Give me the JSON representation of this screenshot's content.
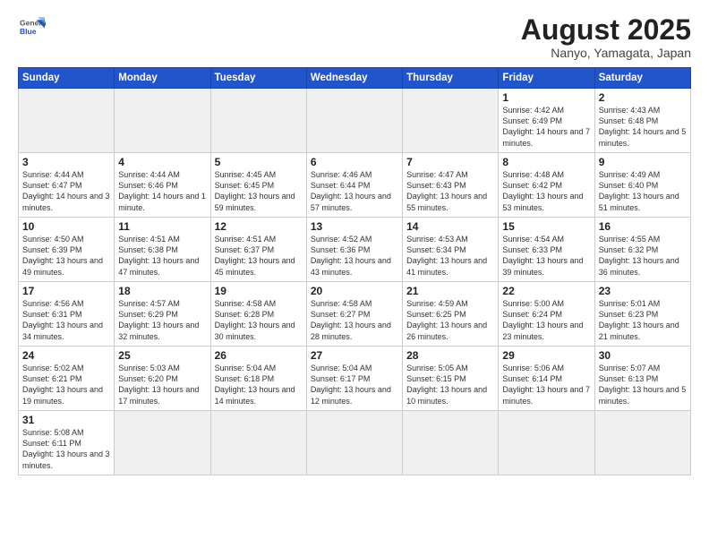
{
  "header": {
    "logo_general": "General",
    "logo_blue": "Blue",
    "month_title": "August 2025",
    "location": "Nanyo, Yamagata, Japan"
  },
  "weekdays": [
    "Sunday",
    "Monday",
    "Tuesday",
    "Wednesday",
    "Thursday",
    "Friday",
    "Saturday"
  ],
  "weeks": [
    [
      {
        "day": "",
        "info": ""
      },
      {
        "day": "",
        "info": ""
      },
      {
        "day": "",
        "info": ""
      },
      {
        "day": "",
        "info": ""
      },
      {
        "day": "",
        "info": ""
      },
      {
        "day": "1",
        "info": "Sunrise: 4:42 AM\nSunset: 6:49 PM\nDaylight: 14 hours\nand 7 minutes."
      },
      {
        "day": "2",
        "info": "Sunrise: 4:43 AM\nSunset: 6:48 PM\nDaylight: 14 hours\nand 5 minutes."
      }
    ],
    [
      {
        "day": "3",
        "info": "Sunrise: 4:44 AM\nSunset: 6:47 PM\nDaylight: 14 hours\nand 3 minutes."
      },
      {
        "day": "4",
        "info": "Sunrise: 4:44 AM\nSunset: 6:46 PM\nDaylight: 14 hours\nand 1 minute."
      },
      {
        "day": "5",
        "info": "Sunrise: 4:45 AM\nSunset: 6:45 PM\nDaylight: 13 hours\nand 59 minutes."
      },
      {
        "day": "6",
        "info": "Sunrise: 4:46 AM\nSunset: 6:44 PM\nDaylight: 13 hours\nand 57 minutes."
      },
      {
        "day": "7",
        "info": "Sunrise: 4:47 AM\nSunset: 6:43 PM\nDaylight: 13 hours\nand 55 minutes."
      },
      {
        "day": "8",
        "info": "Sunrise: 4:48 AM\nSunset: 6:42 PM\nDaylight: 13 hours\nand 53 minutes."
      },
      {
        "day": "9",
        "info": "Sunrise: 4:49 AM\nSunset: 6:40 PM\nDaylight: 13 hours\nand 51 minutes."
      }
    ],
    [
      {
        "day": "10",
        "info": "Sunrise: 4:50 AM\nSunset: 6:39 PM\nDaylight: 13 hours\nand 49 minutes."
      },
      {
        "day": "11",
        "info": "Sunrise: 4:51 AM\nSunset: 6:38 PM\nDaylight: 13 hours\nand 47 minutes."
      },
      {
        "day": "12",
        "info": "Sunrise: 4:51 AM\nSunset: 6:37 PM\nDaylight: 13 hours\nand 45 minutes."
      },
      {
        "day": "13",
        "info": "Sunrise: 4:52 AM\nSunset: 6:36 PM\nDaylight: 13 hours\nand 43 minutes."
      },
      {
        "day": "14",
        "info": "Sunrise: 4:53 AM\nSunset: 6:34 PM\nDaylight: 13 hours\nand 41 minutes."
      },
      {
        "day": "15",
        "info": "Sunrise: 4:54 AM\nSunset: 6:33 PM\nDaylight: 13 hours\nand 39 minutes."
      },
      {
        "day": "16",
        "info": "Sunrise: 4:55 AM\nSunset: 6:32 PM\nDaylight: 13 hours\nand 36 minutes."
      }
    ],
    [
      {
        "day": "17",
        "info": "Sunrise: 4:56 AM\nSunset: 6:31 PM\nDaylight: 13 hours\nand 34 minutes."
      },
      {
        "day": "18",
        "info": "Sunrise: 4:57 AM\nSunset: 6:29 PM\nDaylight: 13 hours\nand 32 minutes."
      },
      {
        "day": "19",
        "info": "Sunrise: 4:58 AM\nSunset: 6:28 PM\nDaylight: 13 hours\nand 30 minutes."
      },
      {
        "day": "20",
        "info": "Sunrise: 4:58 AM\nSunset: 6:27 PM\nDaylight: 13 hours\nand 28 minutes."
      },
      {
        "day": "21",
        "info": "Sunrise: 4:59 AM\nSunset: 6:25 PM\nDaylight: 13 hours\nand 26 minutes."
      },
      {
        "day": "22",
        "info": "Sunrise: 5:00 AM\nSunset: 6:24 PM\nDaylight: 13 hours\nand 23 minutes."
      },
      {
        "day": "23",
        "info": "Sunrise: 5:01 AM\nSunset: 6:23 PM\nDaylight: 13 hours\nand 21 minutes."
      }
    ],
    [
      {
        "day": "24",
        "info": "Sunrise: 5:02 AM\nSunset: 6:21 PM\nDaylight: 13 hours\nand 19 minutes."
      },
      {
        "day": "25",
        "info": "Sunrise: 5:03 AM\nSunset: 6:20 PM\nDaylight: 13 hours\nand 17 minutes."
      },
      {
        "day": "26",
        "info": "Sunrise: 5:04 AM\nSunset: 6:18 PM\nDaylight: 13 hours\nand 14 minutes."
      },
      {
        "day": "27",
        "info": "Sunrise: 5:04 AM\nSunset: 6:17 PM\nDaylight: 13 hours\nand 12 minutes."
      },
      {
        "day": "28",
        "info": "Sunrise: 5:05 AM\nSunset: 6:15 PM\nDaylight: 13 hours\nand 10 minutes."
      },
      {
        "day": "29",
        "info": "Sunrise: 5:06 AM\nSunset: 6:14 PM\nDaylight: 13 hours\nand 7 minutes."
      },
      {
        "day": "30",
        "info": "Sunrise: 5:07 AM\nSunset: 6:13 PM\nDaylight: 13 hours\nand 5 minutes."
      }
    ],
    [
      {
        "day": "31",
        "info": "Sunrise: 5:08 AM\nSunset: 6:11 PM\nDaylight: 13 hours\nand 3 minutes."
      },
      {
        "day": "",
        "info": ""
      },
      {
        "day": "",
        "info": ""
      },
      {
        "day": "",
        "info": ""
      },
      {
        "day": "",
        "info": ""
      },
      {
        "day": "",
        "info": ""
      },
      {
        "day": "",
        "info": ""
      }
    ]
  ]
}
